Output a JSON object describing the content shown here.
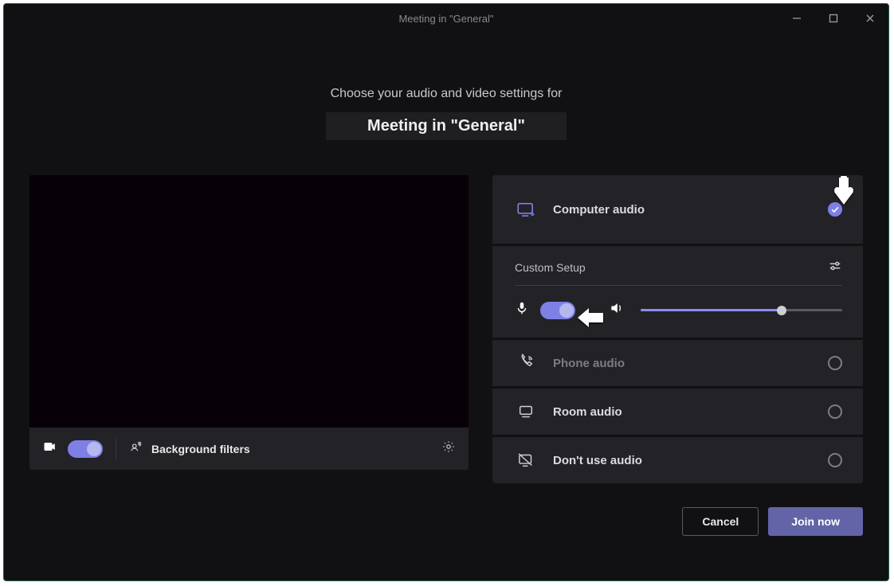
{
  "window": {
    "title": "Meeting in \"General\""
  },
  "heading": {
    "prompt": "Choose your audio and video settings for",
    "meeting_name": "Meeting in \"General\""
  },
  "left": {
    "camera_on": true,
    "background_filters_label": "Background filters"
  },
  "audio": {
    "custom_setup_label": "Custom Setup",
    "mic_on": true,
    "volume": 70,
    "options": {
      "computer": {
        "label": "Computer audio",
        "selected": true,
        "enabled": true
      },
      "phone": {
        "label": "Phone audio",
        "selected": false,
        "enabled": false
      },
      "room": {
        "label": "Room audio",
        "selected": false,
        "enabled": true
      },
      "none": {
        "label": "Don't use audio",
        "selected": false,
        "enabled": true
      }
    }
  },
  "footer": {
    "cancel_label": "Cancel",
    "join_label": "Join now"
  },
  "colors": {
    "accent": "#6264a7",
    "toggle": "#7e80e6"
  }
}
